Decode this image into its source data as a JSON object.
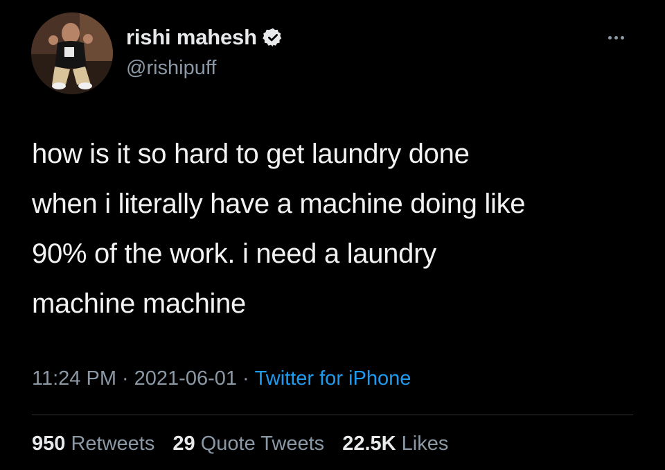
{
  "author": {
    "display_name": "rishi mahesh",
    "handle": "@rishipuff",
    "verified": true
  },
  "tweet": {
    "text_lines": [
      "how is it so hard to get laundry done",
      "when i literally have a machine doing like",
      "90% of the work. i need a laundry",
      "machine machine"
    ],
    "time": "11:24 PM",
    "date": "2021-06-01",
    "source": "Twitter for iPhone",
    "separator": "·"
  },
  "stats": {
    "retweets_count": "950",
    "retweets_label": "Retweets",
    "quotes_count": "29",
    "quotes_label": "Quote Tweets",
    "likes_count": "22.5K",
    "likes_label": "Likes"
  },
  "icons": {
    "verified": "verified-badge-icon",
    "more": "more-options-icon"
  },
  "colors": {
    "background": "#000000",
    "primary_text": "#e7e9ea",
    "secondary_text": "#8b98a5",
    "link": "#1d9bf0",
    "divider": "#2f3336"
  }
}
